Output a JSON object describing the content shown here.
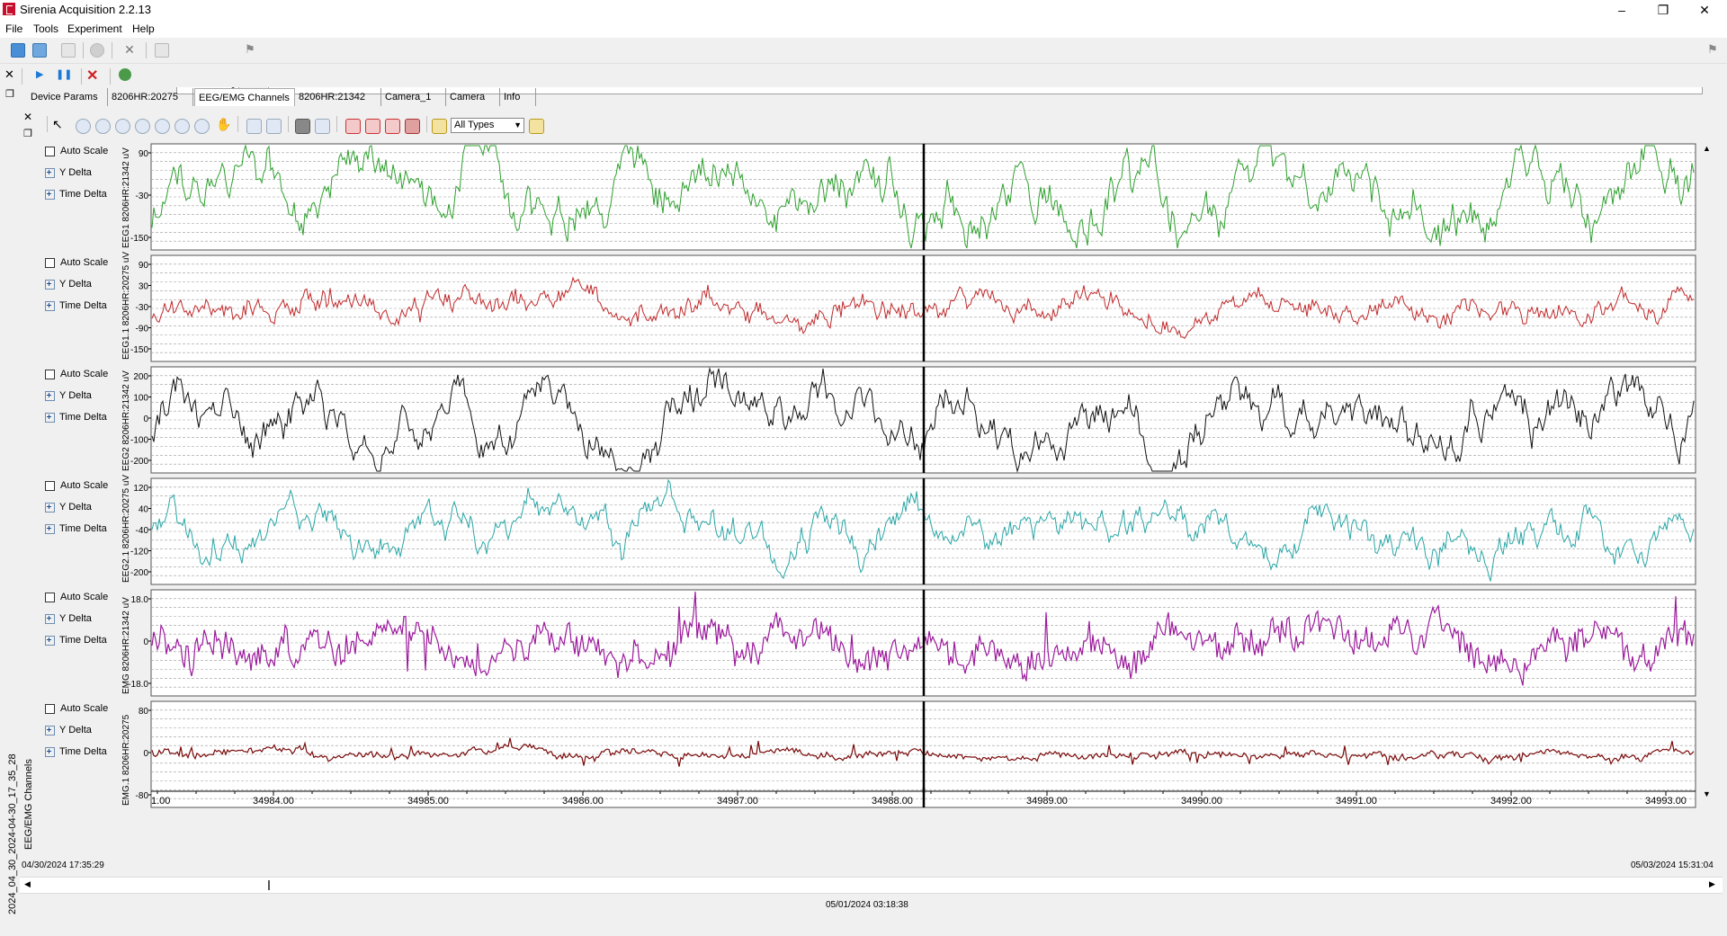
{
  "window": {
    "title": "Sirenia Acquisition 2.2.13"
  },
  "menu": [
    "File",
    "Tools",
    "Experiment",
    "Help"
  ],
  "filter": {
    "selected": "All Types"
  },
  "tabs": [
    "Device Params",
    "8206HR:20275",
    "EEG/EMG Channels",
    "8206HR:21342",
    "Camera_1",
    "Camera",
    "Info"
  ],
  "active_tab": "EEG/EMG Channels",
  "controls": {
    "auto_scale": "Auto Scale",
    "y_delta": "Y Delta",
    "time_delta": "Time Delta"
  },
  "channels": [
    {
      "name": "EEG1 8206HR:21342 uV",
      "color": "#2ea02e",
      "yticks": [
        "90",
        "-30",
        "-150"
      ]
    },
    {
      "name": "EEG1.1 8206HR:20275 uV",
      "color": "#c0282a",
      "yticks": [
        "90",
        "30",
        "-30",
        "-90",
        "-150"
      ]
    },
    {
      "name": "EEG2 8206HR:21342 uV",
      "color": "#111111",
      "yticks": [
        "200",
        "100",
        "0",
        "-100",
        "-200"
      ]
    },
    {
      "name": "EEG2.1 8206HR:20275 uV",
      "color": "#2aa6a6",
      "yticks": [
        "120",
        "40",
        "-40",
        "-120",
        "-200"
      ]
    },
    {
      "name": "EMG 8206HR:21342 uV",
      "color": "#9c1a9c",
      "yticks": [
        "18.0",
        "0",
        "-18.0"
      ]
    },
    {
      "name": "EMG.1 8206HR:20275",
      "color": "#7a0a0a",
      "yticks": [
        "80",
        "0",
        "-80"
      ]
    }
  ],
  "x_axis": {
    "ticks": [
      "34984.00",
      "34985.00",
      "34986.00",
      "34987.00",
      "34988.00",
      "34989.00",
      "34990.00",
      "34991.00",
      "34992.00",
      "34993.00"
    ],
    "first_partial": "1.00"
  },
  "side_panel": {
    "label": "EEG/EMG Channels",
    "date_label": "2024_04_30_2024-04-30_17_35_28"
  },
  "timeline": {
    "start": "04/30/2024 17:35:29",
    "end": "05/03/2024 15:31:04",
    "current": "05/01/2024 03:18:38"
  }
}
